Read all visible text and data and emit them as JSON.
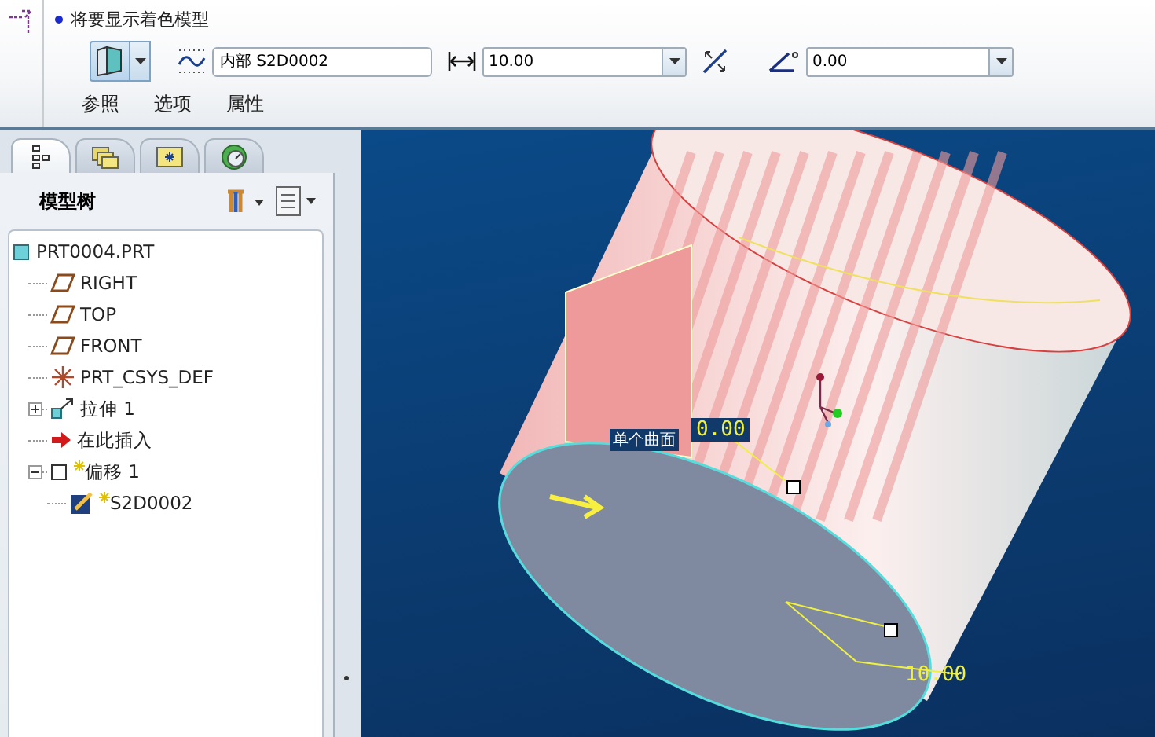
{
  "dashboard": {
    "message": "将要显示着色模型",
    "section_field": {
      "value": "内部 S2D0002"
    },
    "depth_field": {
      "value": "10.00"
    },
    "angle_field": {
      "value": "0.00"
    },
    "tabs": [
      {
        "label": "参照",
        "selected": false
      },
      {
        "label": "选项",
        "selected": false
      },
      {
        "label": "属性",
        "selected": false
      }
    ]
  },
  "navigator": {
    "tabs": [
      {
        "kind": "tree",
        "selected": true
      },
      {
        "kind": "folders",
        "selected": false
      },
      {
        "kind": "favorites",
        "selected": false
      },
      {
        "kind": "history",
        "selected": false
      }
    ],
    "title": "模型树",
    "tree": [
      {
        "kind": "part",
        "label": "PRT0004.PRT",
        "pending": false,
        "children": [
          {
            "kind": "plane",
            "label": "RIGHT",
            "pending": false
          },
          {
            "kind": "plane",
            "label": "TOP",
            "pending": false
          },
          {
            "kind": "plane",
            "label": "FRONT",
            "pending": false
          },
          {
            "kind": "csys",
            "label": "PRT_CSYS_DEF",
            "pending": false
          },
          {
            "kind": "extrude",
            "label": "拉伸 1",
            "pending": false,
            "expanded": false
          },
          {
            "kind": "insert",
            "label": "在此插入",
            "pending": false
          },
          {
            "kind": "offset",
            "label": "偏移 1",
            "pending": true,
            "expanded": true,
            "children": [
              {
                "kind": "sketch",
                "label": "S2D0002",
                "pending": true
              }
            ]
          }
        ]
      }
    ]
  },
  "viewport": {
    "labels": [
      {
        "kind": "surface",
        "text": "单个曲面"
      },
      {
        "kind": "dimension",
        "text": "0.00"
      },
      {
        "kind": "dimension_plain",
        "text": "10.00"
      }
    ]
  }
}
